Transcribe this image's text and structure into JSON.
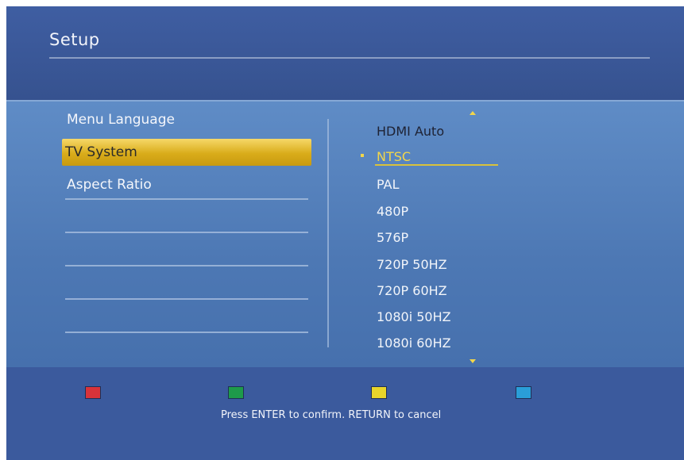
{
  "header": {
    "title": "Setup"
  },
  "menu": {
    "items": [
      {
        "label": "Menu Language"
      },
      {
        "label": "TV System"
      },
      {
        "label": "Aspect Ratio"
      }
    ]
  },
  "options": {
    "items": [
      {
        "label": "HDMI Auto"
      },
      {
        "label": "NTSC"
      },
      {
        "label": "PAL"
      },
      {
        "label": "480P"
      },
      {
        "label": "576P"
      },
      {
        "label": "720P 50HZ"
      },
      {
        "label": "720P 60HZ"
      },
      {
        "label": "1080i 50HZ"
      },
      {
        "label": "1080i 60HZ"
      }
    ]
  },
  "footer": {
    "hint": "Press ENTER to confirm. RETURN to cancel",
    "keys": [
      {
        "name": "red",
        "color": "#d9333a"
      },
      {
        "name": "green",
        "color": "#1e9a4a"
      },
      {
        "name": "yellow",
        "color": "#e8d42a"
      },
      {
        "name": "blue",
        "color": "#2a9ed8"
      }
    ]
  },
  "colors": {
    "selection": "#e0b52a",
    "background": "#3d5a9c"
  }
}
